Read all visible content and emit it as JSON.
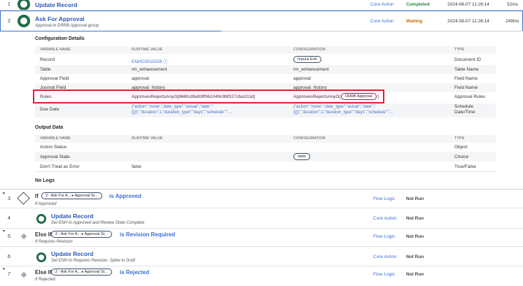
{
  "steps": {
    "s1": {
      "num": "1",
      "title": "Update Record",
      "category": "Core Action",
      "state": "Completed",
      "started": "2024-08-07 11:26:14",
      "duration": "52ms"
    },
    "s2": {
      "num": "2",
      "title": "Ask For Approval",
      "subtitle": "Approval to DRRB Approval group",
      "category": "Core Action",
      "state": "Waiting",
      "started": "2024-08-07 11:26:14",
      "duration": "249ms"
    },
    "s3": {
      "num": "3",
      "keyword": "If",
      "pill": "2 - Ask For A... ▸ Approval St...",
      "condition": "is Approved",
      "subtitle": "If Approved",
      "category": "Flow Logic",
      "state": "Not Run"
    },
    "s4": {
      "num": "4",
      "title": "Update Record",
      "subtitle": "Set ENH to Approved and Review State Complete",
      "category": "Core Action",
      "state": "Not Run"
    },
    "s5": {
      "num": "5",
      "keyword": "Else If",
      "pill": "2 - Ask For A... ▸ Approval St...",
      "condition": "is Revision Required",
      "subtitle": "If Requires Revision",
      "category": "Flow Logic",
      "state": "Not Run"
    },
    "s6": {
      "num": "6",
      "title": "Update Record",
      "subtitle": "Set ENH to Requires Revision, Spike to Draft",
      "category": "Core Action",
      "state": "Not Run"
    },
    "s7": {
      "num": "7",
      "keyword": "Else If",
      "pill": "2 - Ask For A... ▸ Approval St...",
      "condition": "is Rejected",
      "subtitle": "If Rejected",
      "category": "Flow Logic",
      "state": "Not Run"
    }
  },
  "config": {
    "heading": "Configuration Details",
    "headers": {
      "var": "VARIABLE NAME",
      "runtime": "RUNTIME VALUE",
      "config": "CONFIGURATION",
      "type": "TYPE"
    },
    "rows": {
      "record": {
        "name": "Record",
        "runtime": "ENHC0011528 ⓘ",
        "config": "Input ▸ Enh",
        "type": "Document ID"
      },
      "table": {
        "name": "Table",
        "runtime": "rm_enhancement",
        "config": "rm_enhancement",
        "type": "Table Name"
      },
      "approval_field": {
        "name": "Approval Field",
        "runtime": "approval",
        "config": "approval",
        "type": "Field Name"
      },
      "journal_field": {
        "name": "Journal Field",
        "runtime": "approval_history",
        "config": "approval_history",
        "type": "Field Name"
      },
      "rules": {
        "name": "Rules",
        "runtime": "ApprovesRejectsAnyG[866fcd9a93ff061049c9bf027cba101d]",
        "config_prefix": "ApprovesRejectsAnyG[",
        "config_pill": "DRRB Approval",
        "config_suffix": "]",
        "type": "Approval Rules"
      },
      "due_date": {
        "name": "Due Date",
        "runtime": "{\"action\":\"none\",\"date_type\":\"actual\",\"date\":\"{{}}\",\"duration\":1,\"duration_type\":\"days\",\"schedule\":\"...",
        "config": "{\"action\":\"none\",\"date_type\":\"actual\",\"date\":\"{{}}\",\"duration\":1,\"duration_type\":\"days\",\"schedule\":\"...",
        "type": "Schedule Date/Time"
      }
    }
  },
  "output": {
    "heading": "Output Data",
    "rows": {
      "action_status": {
        "name": "Action Status",
        "runtime": "",
        "config": "",
        "type": "Object"
      },
      "approval_state": {
        "name": "Approval State",
        "runtime": "",
        "config": "state",
        "type": "Choice"
      },
      "dont_treat": {
        "name": "Don't Treat as Error",
        "runtime": "false",
        "config": "",
        "type": "True/False"
      }
    }
  },
  "logs": {
    "heading": "No Logs"
  },
  "colors": {
    "highlight": "#d9232d",
    "link": "#2b57b8",
    "success": "#1f8a3a",
    "waiting": "#c26a00"
  }
}
